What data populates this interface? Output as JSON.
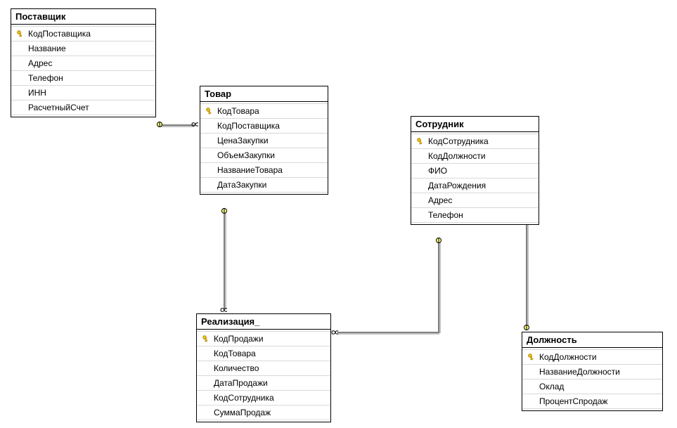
{
  "tables": {
    "supplier": {
      "title": "Поставщик",
      "fields": [
        {
          "name": "КодПоставщика",
          "pk": true
        },
        {
          "name": "Название",
          "pk": false
        },
        {
          "name": "Адрес",
          "pk": false
        },
        {
          "name": "Телефон",
          "pk": false
        },
        {
          "name": "ИНН",
          "pk": false
        },
        {
          "name": "РасчетныйСчет",
          "pk": false
        }
      ]
    },
    "product": {
      "title": "Товар",
      "fields": [
        {
          "name": "КодТовара",
          "pk": true
        },
        {
          "name": "КодПоставщика",
          "pk": false
        },
        {
          "name": "ЦенаЗакупки",
          "pk": false
        },
        {
          "name": "ОбъемЗакупки",
          "pk": false
        },
        {
          "name": "НазваниеТовара",
          "pk": false
        },
        {
          "name": "ДатаЗакупки",
          "pk": false
        }
      ]
    },
    "employee": {
      "title": "Сотрудник",
      "fields": [
        {
          "name": "КодСотрудника",
          "pk": true
        },
        {
          "name": "КодДолжности",
          "pk": false
        },
        {
          "name": "ФИО",
          "pk": false
        },
        {
          "name": "ДатаРождения",
          "pk": false
        },
        {
          "name": "Адрес",
          "pk": false
        },
        {
          "name": "Телефон",
          "pk": false
        }
      ]
    },
    "sale": {
      "title": "Реализация_",
      "fields": [
        {
          "name": "КодПродажи",
          "pk": true
        },
        {
          "name": "КодТовара",
          "pk": false
        },
        {
          "name": "Количество",
          "pk": false
        },
        {
          "name": "ДатаПродажи",
          "pk": false
        },
        {
          "name": "КодСотрудника",
          "pk": false
        },
        {
          "name": "СуммаПродаж",
          "pk": false
        }
      ]
    },
    "position": {
      "title": "Должность",
      "fields": [
        {
          "name": "КодДолжности",
          "pk": true
        },
        {
          "name": "НазваниеДолжности",
          "pk": false
        },
        {
          "name": "Оклад",
          "pk": false
        },
        {
          "name": "ПроцентСпродаж",
          "pk": false
        }
      ]
    }
  },
  "relationships": [
    {
      "from": "supplier",
      "to": "product",
      "type": "one-to-many"
    },
    {
      "from": "product",
      "to": "sale",
      "type": "one-to-many"
    },
    {
      "from": "employee",
      "to": "sale",
      "type": "one-to-many"
    },
    {
      "from": "position",
      "to": "employee",
      "type": "one-to-many"
    }
  ]
}
